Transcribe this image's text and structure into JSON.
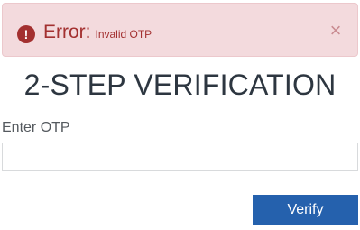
{
  "alert": {
    "heading": "Error:",
    "message": "Invalid OTP",
    "icon": "exclamation-circle-icon",
    "icon_glyph": "!",
    "close_glyph": "×"
  },
  "title": "2-STEP VERIFICATION",
  "otp": {
    "label": "Enter OTP",
    "value": "",
    "placeholder": ""
  },
  "verify_button": {
    "label": "Verify"
  },
  "colors": {
    "alert_background": "#f3dadd",
    "alert_text": "#a33030",
    "primary_button": "#2561ad",
    "title_text": "#2d3640"
  }
}
